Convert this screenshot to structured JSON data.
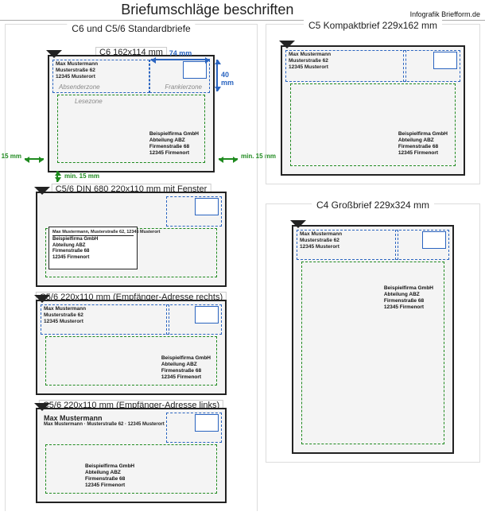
{
  "title": "Briefumschläge beschriften",
  "site": "Infografik Briefform.de",
  "left_group_label": "C6 und C5/6 Standardbriefe",
  "sender": {
    "l1": "Max Mustermann",
    "l2": "Musterstraße 62",
    "l3": "12345 Musterort"
  },
  "sender_oneline": "Max Mustermann, Musterstraße 62, 12345 Musterort",
  "sender_oneline_ms62": "Max Mustermann · Musterstraße 62 · 12345 Musterort",
  "recipient": {
    "l1": "Beispielfirma GmbH",
    "l2": "Abteilung ABZ",
    "l3": "Firmenstraße 68",
    "l4": "12345 Firmenort"
  },
  "zones": {
    "absender": "Absenderzone",
    "frankier": "Frankierzone",
    "lese": "Lesezone"
  },
  "meas": {
    "w74": "74 mm",
    "h40": "40 mm",
    "min15": "min. 15 mm"
  },
  "envelopes": {
    "c6": {
      "header": "C6 162x114 mm"
    },
    "c56win": {
      "header": "C5/6 DIN 680 220x110 mm mit Fenster"
    },
    "c56r": {
      "header": "C5/6 220x110 mm (Empfänger-Adresse rechts)"
    },
    "c56l": {
      "header": "C5/6 220x110 mm (Empfänger-Adresse links)"
    },
    "c5": {
      "header": "C5 Kompaktbrief 229x162 mm"
    },
    "c4": {
      "header": "C4 Großbrief 229x324 mm"
    }
  }
}
